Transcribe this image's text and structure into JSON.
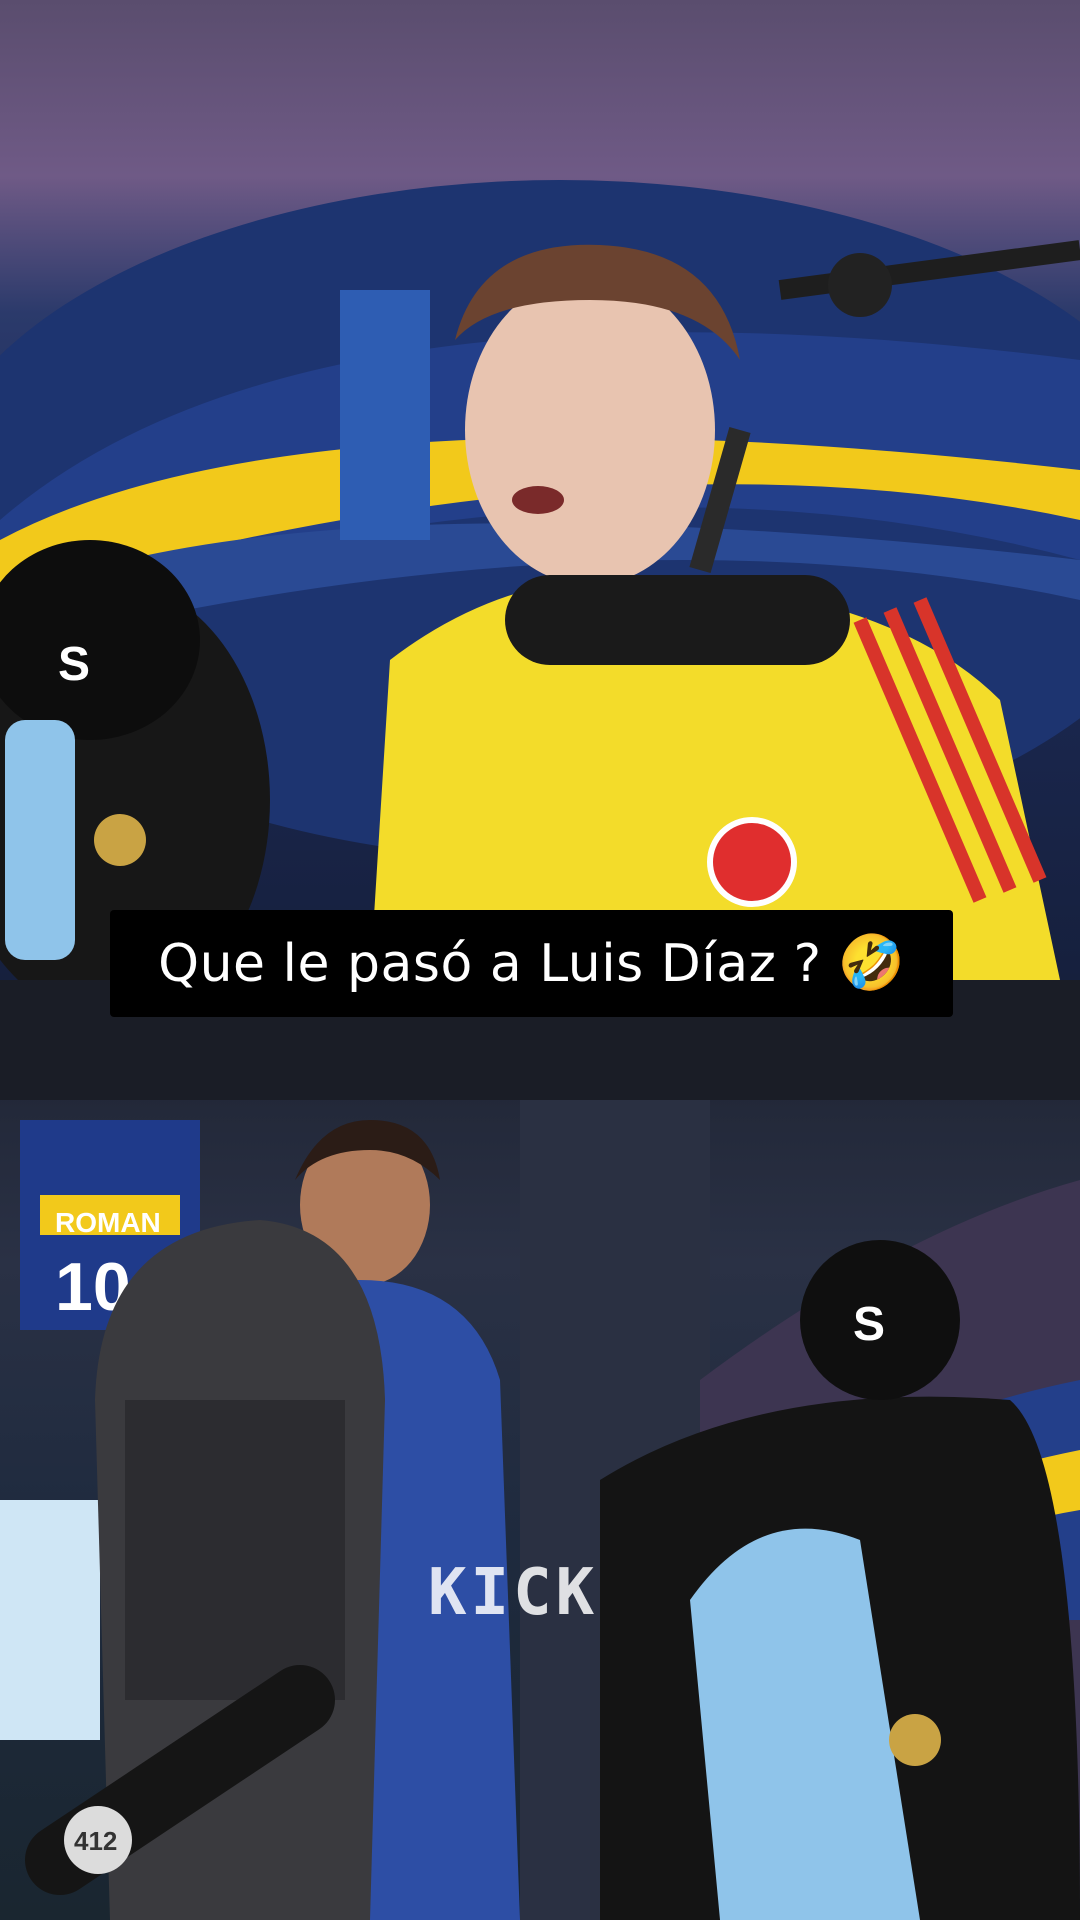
{
  "caption": {
    "text": "Que le pasó a Luis Díaz ?",
    "emoji": "🤣"
  },
  "watermark": {
    "text": "KICK"
  },
  "scene": {
    "top_description_icon": "video-frame",
    "bottom_description_icon": "video-frame",
    "mural_jersey_name": "ROMAN",
    "mural_jersey_number": "10",
    "cap_letter": "S",
    "mic_badge_text": "412"
  },
  "colors": {
    "jersey_yellow": "#f3dc2a",
    "stripe_red": "#d8342a",
    "scarf_blue": "#8fc4ea",
    "cap_black": "#111111"
  }
}
